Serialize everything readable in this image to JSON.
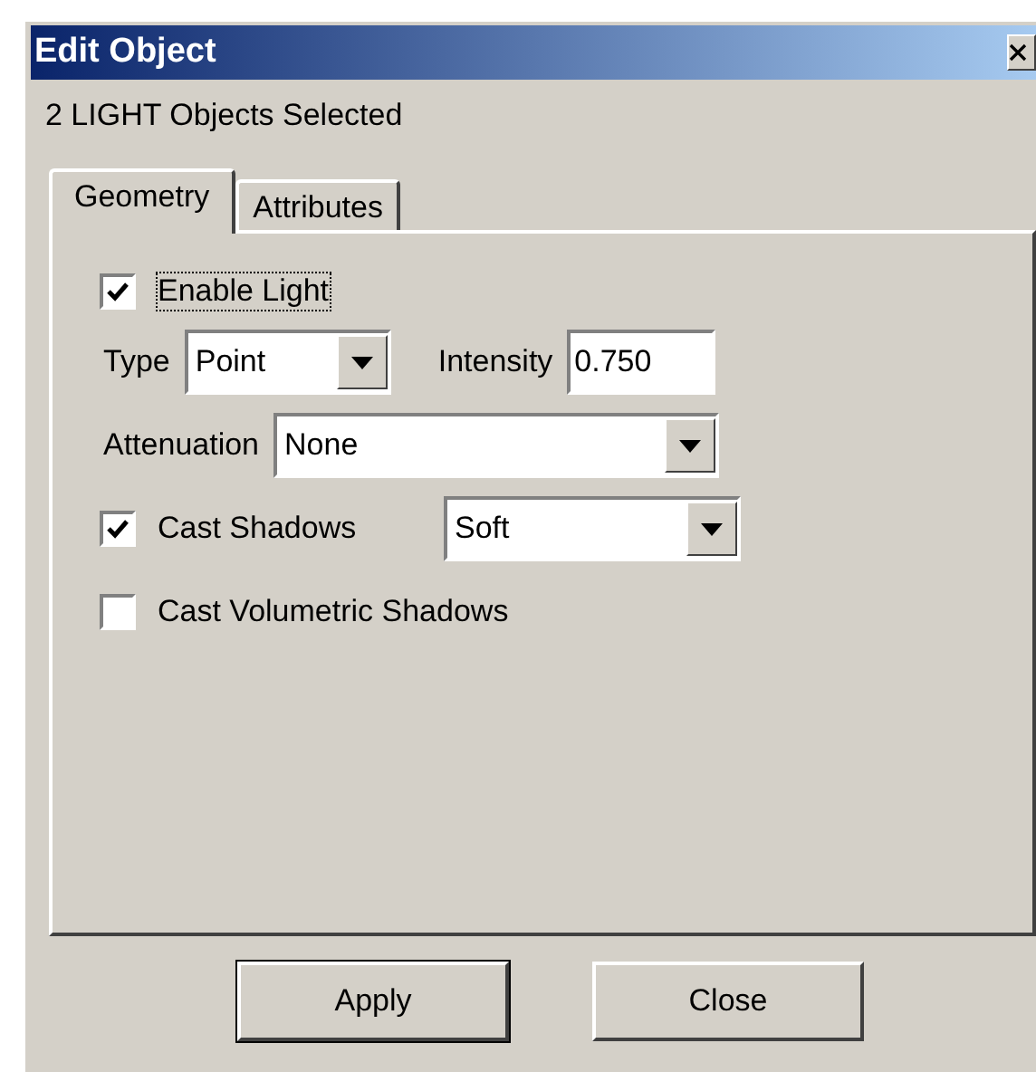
{
  "window": {
    "title": "Edit Object"
  },
  "subtitle": "2 LIGHT Objects Selected",
  "tabs": [
    {
      "label": "Geometry",
      "selected": true
    },
    {
      "label": "Attributes",
      "selected": false
    }
  ],
  "geometry": {
    "enable_light": {
      "label": "Enable Light",
      "checked": true
    },
    "type": {
      "label": "Type",
      "value": "Point"
    },
    "intensity": {
      "label": "Intensity",
      "value": "0.750"
    },
    "attenuation": {
      "label": "Attenuation",
      "value": "None"
    },
    "cast_shadows": {
      "label": "Cast Shadows",
      "checked": true,
      "value": "Soft"
    },
    "cast_volumetric_shadows": {
      "label": "Cast Volumetric Shadows",
      "checked": false
    }
  },
  "buttons": [
    {
      "label": "Apply",
      "default": true
    },
    {
      "label": "Close",
      "default": false
    }
  ]
}
